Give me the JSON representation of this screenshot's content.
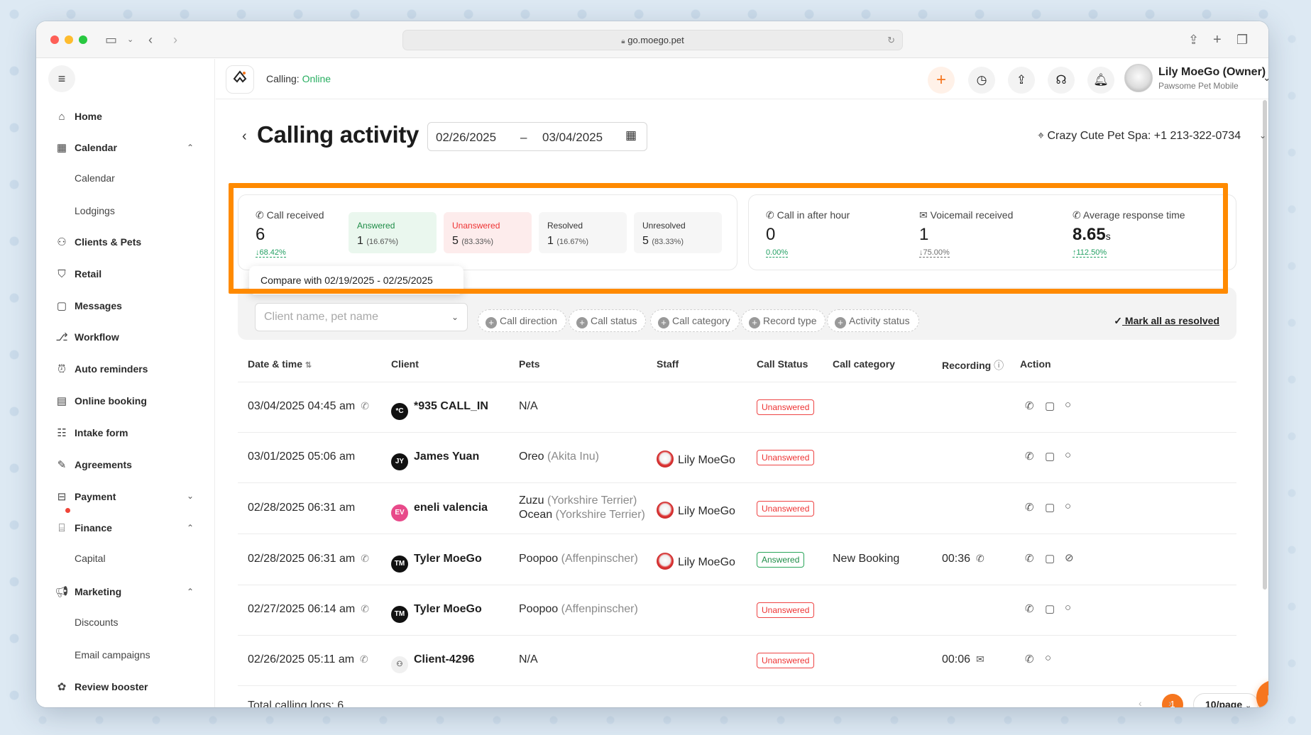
{
  "browser": {
    "url": "go.moego.pet"
  },
  "sidebar": {
    "items": [
      {
        "label": "Home",
        "icon": "home-icon"
      },
      {
        "label": "Calendar",
        "icon": "calendar-icon"
      },
      {
        "label": "Calendar"
      },
      {
        "label": "Lodgings"
      },
      {
        "label": "Clients & Pets",
        "icon": "clients-icon"
      },
      {
        "label": "Retail",
        "icon": "retail-icon"
      },
      {
        "label": "Messages",
        "icon": "messages-icon"
      },
      {
        "label": "Workflow",
        "icon": "workflow-icon"
      },
      {
        "label": "Auto reminders",
        "icon": "alarm-icon"
      },
      {
        "label": "Online booking",
        "icon": "booking-icon"
      },
      {
        "label": "Intake form",
        "icon": "form-icon"
      },
      {
        "label": "Agreements",
        "icon": "pen-icon"
      },
      {
        "label": "Payment",
        "icon": "payment-icon"
      },
      {
        "label": "Finance",
        "icon": "bank-icon"
      },
      {
        "label": "Capital"
      },
      {
        "label": "Marketing",
        "icon": "megaphone-icon"
      },
      {
        "label": "Discounts"
      },
      {
        "label": "Email campaigns"
      },
      {
        "label": "Review booster",
        "icon": "review-icon"
      }
    ]
  },
  "topbar": {
    "calling_label": "Calling:",
    "calling_status": "Online",
    "user_name": "Lily MoeGo (Owner)",
    "user_business": "Pawsome Pet Mobile"
  },
  "page": {
    "title": "Calling activity",
    "date_start": "02/26/2025",
    "date_end": "03/04/2025",
    "date_sep": "–",
    "location": "Crazy Cute Pet Spa: +1 213-322-0734"
  },
  "stats": {
    "call_received": {
      "label": "Call received",
      "value": "6",
      "change": "↓68.42%"
    },
    "answered": {
      "label": "Answered",
      "value": "1",
      "pct": "(16.67%)"
    },
    "unanswered": {
      "label": "Unanswered",
      "value": "5",
      "pct": "(83.33%)"
    },
    "resolved": {
      "label": "Resolved",
      "value": "1",
      "pct": "(16.67%)"
    },
    "unresolved": {
      "label": "Unresolved",
      "value": "5",
      "pct": "(83.33%)"
    },
    "after_hour": {
      "label": "Call in after hour",
      "value": "0",
      "change": "0.00%"
    },
    "voicemail": {
      "label": "Voicemail received",
      "value": "1",
      "change": "↓75.00%"
    },
    "avg_response": {
      "label": "Average response time",
      "value": "8.65",
      "unit": "s",
      "change": "↑112.50%"
    },
    "compare_tooltip": "Compare with 02/19/2025 - 02/25/2025"
  },
  "filters": {
    "search_placeholder": "Client name, pet name",
    "chips": [
      "Call direction",
      "Call status",
      "Call category",
      "Record type",
      "Activity status"
    ],
    "mark_all": "Mark all as resolved"
  },
  "table": {
    "headers": [
      "Date & time",
      "Client",
      "Pets",
      "Staff",
      "Call Status",
      "Call category",
      "Recording",
      "Action"
    ],
    "rows": [
      {
        "datetime": "03/04/2025 04:45 am",
        "initials": "*C",
        "client": "*935 CALL_IN",
        "pet1": "N/A",
        "breed1": "",
        "pet2": "",
        "breed2": "",
        "staff": "",
        "status": "Unanswered",
        "category": "",
        "recording": ""
      },
      {
        "datetime": "03/01/2025 05:06 am",
        "initials": "JY",
        "client": "James Yuan",
        "pet1": "Oreo",
        "breed1": "(Akita Inu)",
        "pet2": "",
        "breed2": "",
        "staff": "Lily MoeGo",
        "status": "Unanswered",
        "category": "",
        "recording": ""
      },
      {
        "datetime": "02/28/2025 06:31 am",
        "initials": "EV",
        "client": "eneli valencia",
        "pet1": "Zuzu",
        "breed1": "(Yorkshire Terrier)",
        "pet2": "Ocean",
        "breed2": "(Yorkshire Terrier)",
        "staff": "Lily MoeGo",
        "status": "Unanswered",
        "category": "",
        "recording": ""
      },
      {
        "datetime": "02/28/2025 06:31 am",
        "initials": "TM",
        "client": "Tyler MoeGo",
        "pet1": "Poopoo",
        "breed1": "(Affenpinscher)",
        "pet2": "",
        "breed2": "",
        "staff": "Lily MoeGo",
        "status": "Answered",
        "category": "New Booking",
        "recording": "00:36"
      },
      {
        "datetime": "02/27/2025 06:14 am",
        "initials": "TM",
        "client": "Tyler MoeGo",
        "pet1": "Poopoo",
        "breed1": "(Affenpinscher)",
        "pet2": "",
        "breed2": "",
        "staff": "",
        "status": "Unanswered",
        "category": "",
        "recording": ""
      },
      {
        "datetime": "02/26/2025 05:11 am",
        "initials": "",
        "client": "Client-4296",
        "pet1": "N/A",
        "breed1": "",
        "pet2": "",
        "breed2": "",
        "staff": "",
        "status": "Unanswered",
        "category": "",
        "recording": "00:06"
      }
    ],
    "total": "Total calling logs: 6",
    "page": "1",
    "page_size": "10/page"
  },
  "colors": {
    "accent": "#f6761f",
    "highlight": "#ff8a00",
    "online": "#27ae60",
    "unanswered": "#e33333",
    "answered": "#1e8c47"
  }
}
